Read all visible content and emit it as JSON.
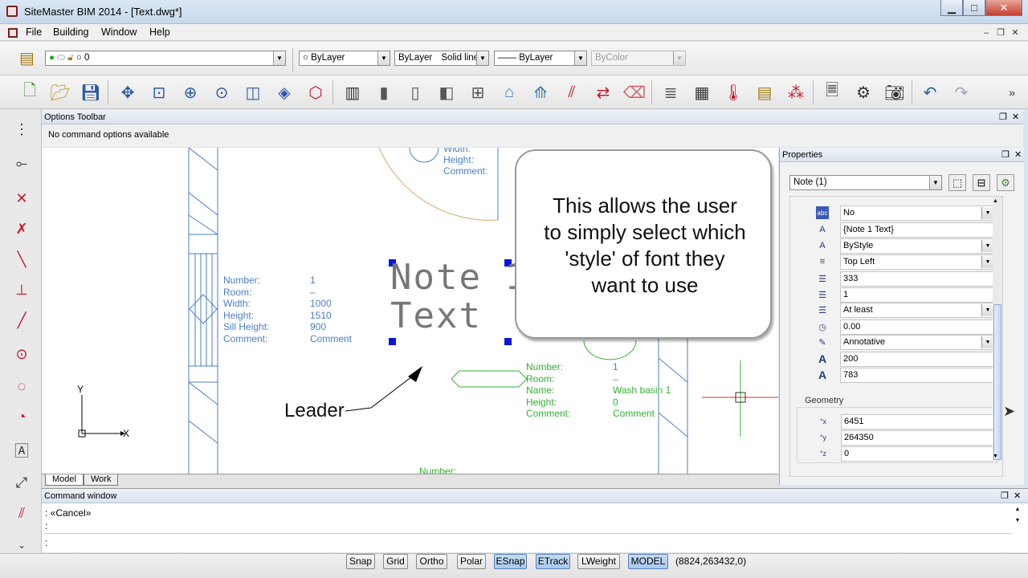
{
  "window": {
    "title": "SiteMaster BIM 2014 - [Text.dwg*]",
    "minimize": "▁",
    "maximize": "□",
    "close": "✕"
  },
  "menu": {
    "items": [
      "File",
      "Building",
      "Window",
      "Help"
    ],
    "mdi_minimize": "–",
    "mdi_restore": "❐",
    "mdi_close": "✕"
  },
  "layer_toolbar": {
    "layer": "0",
    "color": "ByLayer",
    "linetype_prefix": "ByLayer",
    "linetype": "Solid line",
    "lineweight": "—— ByLayer",
    "plotstyle": "ByColor"
  },
  "options_toolbar": {
    "title": "Options Toolbar",
    "message": "No command options available"
  },
  "canvas": {
    "window_labels": [
      "Width:",
      "Height:",
      "Comment:"
    ],
    "door_labels": [
      "Number:",
      "Room:",
      "Width:",
      "Height:",
      "Sill Height:",
      "Comment:"
    ],
    "door_values": [
      "1",
      "–",
      "1000",
      "1510",
      "900",
      "Comment"
    ],
    "note_line1": "Note 1",
    "note_line2": "Text",
    "leader_label": "Leader",
    "room_labels": [
      "Number:",
      "Room:",
      "Name:",
      "Height:",
      "Comment:"
    ],
    "room_values": [
      "1",
      "–",
      "Wash basin 1",
      "0",
      "Comment"
    ],
    "bottom_label": "Number:",
    "axis_x": "X",
    "axis_y": "Y"
  },
  "tabs": [
    "Model",
    "Work"
  ],
  "properties": {
    "title": "Properties",
    "selector": "Note (1)",
    "rows": [
      {
        "icon": "abc",
        "value": "No",
        "dropdown": true
      },
      {
        "icon": "A",
        "value": "{Note 1 Text}",
        "dropdown": false
      },
      {
        "icon": "A",
        "value": "ByStyle",
        "dropdown": true
      },
      {
        "icon": "≡",
        "value": "Top Left",
        "dropdown": true
      },
      {
        "icon": "☰",
        "value": "333",
        "dropdown": false
      },
      {
        "icon": "☰",
        "value": "1",
        "dropdown": false
      },
      {
        "icon": "☰",
        "value": "At least",
        "dropdown": true
      },
      {
        "icon": "◷",
        "value": "0.00",
        "dropdown": false
      },
      {
        "icon": "✎",
        "value": "Annotative",
        "dropdown": true
      },
      {
        "icon": "A",
        "value": "200",
        "dropdown": false
      },
      {
        "icon": "A",
        "value": "783",
        "dropdown": false
      }
    ],
    "geometry_title": "Geometry",
    "geometry": [
      {
        "icon": "°x",
        "value": "6451"
      },
      {
        "icon": "°y",
        "value": "264350"
      },
      {
        "icon": "°z",
        "value": "0"
      }
    ]
  },
  "callout": {
    "lines": [
      "This allows the user",
      "to simply select which",
      "'style' of font they",
      "want to use"
    ]
  },
  "command_window": {
    "title": "Command window",
    "lines": [
      ": «Cancel»",
      ":",
      ":"
    ]
  },
  "status": {
    "buttons": [
      {
        "label": "Snap",
        "on": false
      },
      {
        "label": "Grid",
        "on": false
      },
      {
        "label": "Ortho",
        "on": false
      },
      {
        "label": "Polar",
        "on": false
      },
      {
        "label": "ESnap",
        "on": true
      },
      {
        "label": "ETrack",
        "on": true
      },
      {
        "label": "LWeight",
        "on": false
      },
      {
        "label": "MODEL",
        "on": true
      }
    ],
    "coords": "(8824,263432,0)"
  },
  "colors": {
    "accent": "#2d5aa8",
    "cad_line": "#4a7fc0",
    "room_green": "#33b033",
    "grip_blue": "#0a17d8"
  }
}
